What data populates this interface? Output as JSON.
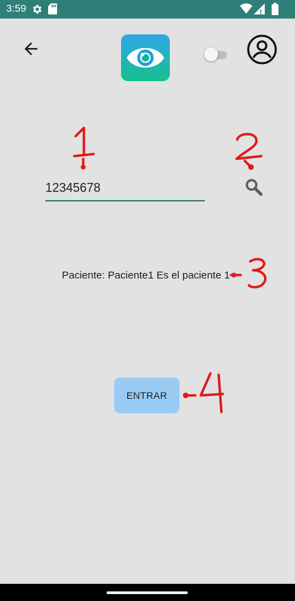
{
  "status_bar": {
    "time": "3:59",
    "icons": [
      "settings-gear-icon",
      "sd-card-icon",
      "wifi-icon",
      "cell-signal-icon",
      "battery-icon"
    ],
    "background_color": "#2e7f77"
  },
  "header": {
    "back_icon": "arrow-left-icon",
    "logo_icon": "eye-icon",
    "toggle_on": false,
    "profile_icon": "account-circle-icon"
  },
  "search": {
    "input_value": "12345678",
    "search_icon": "magnifier-icon",
    "underline_color": "#2e7f77"
  },
  "patient": {
    "label": "Paciente: Paciente1 Es el paciente 1"
  },
  "actions": {
    "enter_label": "ENTRAR",
    "enter_color": "#99ccf5"
  },
  "annotations": {
    "color": "#e0191b",
    "labels": [
      "1",
      "2",
      "3",
      "4"
    ]
  }
}
